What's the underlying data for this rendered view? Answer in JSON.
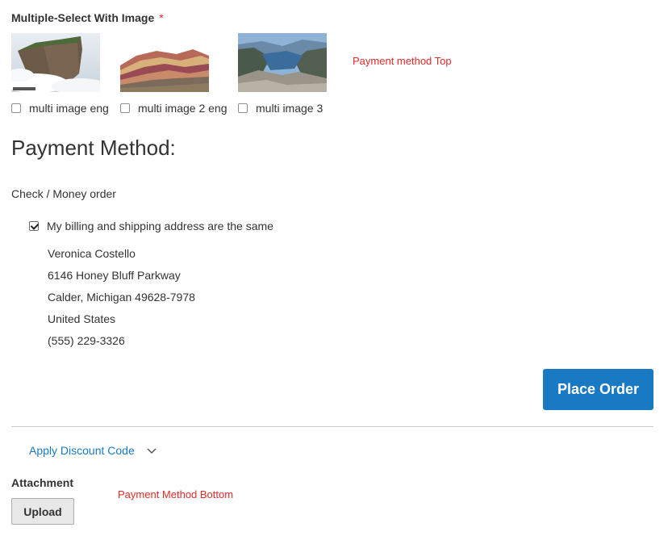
{
  "multiselect": {
    "title": "Multiple-Select With Image",
    "required_mark": "*",
    "options": [
      {
        "label": "multi image eng",
        "checked": false,
        "image": "tepui-cliff-image"
      },
      {
        "label": "multi image 2 eng",
        "checked": false,
        "image": "rainbow-mountain-image"
      },
      {
        "label": "multi image 3",
        "checked": false,
        "image": "fjord-view-image"
      }
    ]
  },
  "notes": {
    "top": "Payment method Top",
    "bottom": "Payment Method Bottom"
  },
  "payment": {
    "title": "Payment Method:",
    "method_label": "Check / Money order",
    "same_address_label": "My billing and shipping address are the same",
    "same_address_checked": true,
    "address": {
      "name": "Veronica Costello",
      "street": "6146 Honey Bluff Parkway",
      "city_line": "Calder, Michigan 49628-7978",
      "country": "United States",
      "phone": "(555) 229-3326"
    },
    "place_order_label": "Place Order"
  },
  "discount": {
    "label": "Apply Discount Code"
  },
  "attachment": {
    "title": "Attachment",
    "upload_label": "Upload"
  },
  "colors": {
    "primary": "#1979c3",
    "required": "#e02b27",
    "text": "#333333",
    "divider": "#cccccc"
  }
}
